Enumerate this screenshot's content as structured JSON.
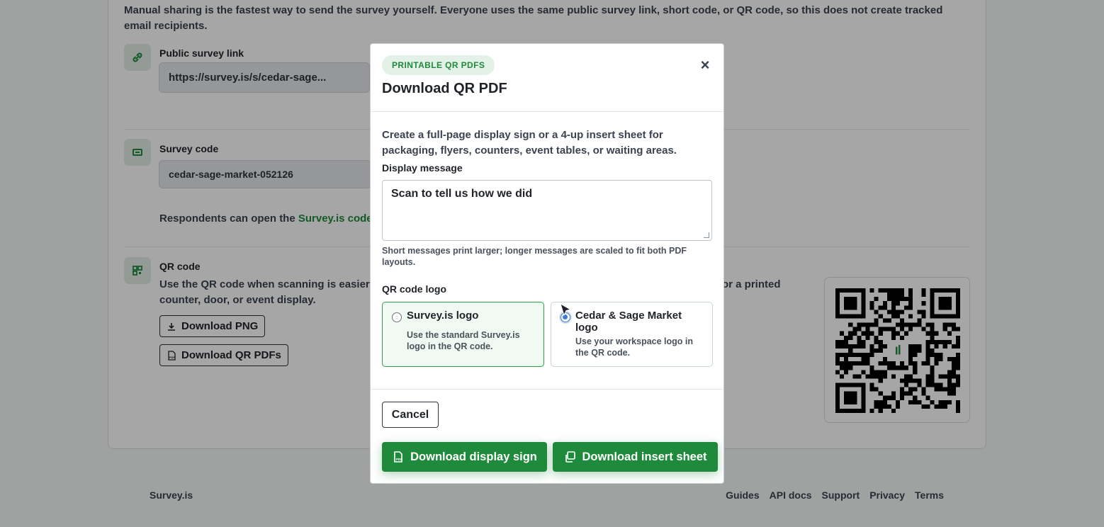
{
  "background": {
    "intro_text": "Manual sharing is the fastest way to send the survey yourself. Everyone uses the same public survey link, short code, or QR code, so this does not create tracked email recipients.",
    "public_link": {
      "title": "Public survey link",
      "value": "https://survey.is/s/cedar-sage..."
    },
    "survey_code": {
      "title": "Survey code",
      "value": "cedar-sage-market-052126",
      "respondents_prefix": "Respondents can open the ",
      "respondents_link": "Survey.is code e"
    },
    "qr_code": {
      "title": "QR code",
      "description_left": "Use the QR code when scanning is easier th",
      "description_left_line2": "counter, door, or event display.",
      "description_right": "or a printed",
      "download_png_label": "Download PNG",
      "download_pdfs_label": "Download QR PDFs"
    },
    "footer": {
      "brand": "Survey.is",
      "links": [
        "Guides",
        "API docs",
        "Support",
        "Privacy",
        "Terms"
      ]
    }
  },
  "modal": {
    "badge": "PRINTABLE QR PDFS",
    "title": "Download QR PDF",
    "close_symbol": "×",
    "description": "Create a full-page display sign or a 4-up insert sheet for packaging, flyers, counters, event tables, or waiting areas.",
    "display_message_label": "Display message",
    "display_message_value": "Scan to tell us how we did",
    "hint": "Short messages print larger; longer messages are scaled to fit both PDF layouts.",
    "logo_label": "QR code logo",
    "options": [
      {
        "title": "Survey.is logo",
        "description": "Use the standard Survey.is logo in the QR code."
      },
      {
        "title": "Cedar & Sage Market logo",
        "description": "Use your workspace logo in the QR code."
      }
    ],
    "selected_option": 1,
    "cancel_label": "Cancel",
    "display_sign_label": "Download display sign",
    "insert_sheet_label": "Download insert sheet"
  },
  "colors": {
    "accent": "#1f8a3b",
    "overlay": "rgba(0,0,0,0.35)"
  }
}
